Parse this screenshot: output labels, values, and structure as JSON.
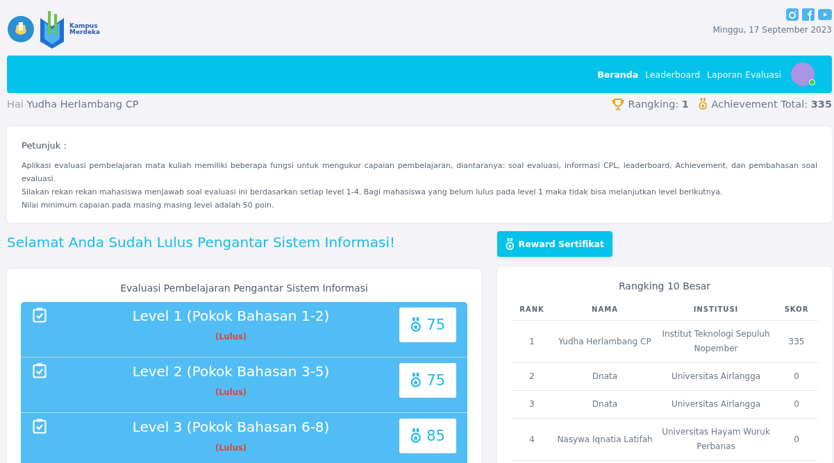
{
  "logo": {
    "line_1": "Kampus",
    "line_2": "Merdeka"
  },
  "date": "Minggu, 17 September 2023",
  "nav": [
    {
      "label": "Beranda",
      "selected": true
    },
    {
      "label": "Leaderboard",
      "selected": false
    },
    {
      "label": "Laporan Evaluasi",
      "selected": false
    }
  ],
  "user": {
    "online": true
  },
  "greeting": {
    "prefix": "Hai",
    "name": "Yudha Herlambang CP"
  },
  "stats": {
    "rank_label": "Rangking:",
    "rank": "1",
    "achievement_label": "Achievement Total:",
    "achievement": "335"
  },
  "instructions": {
    "title": "Petunjuk :",
    "paragraphs": [
      "Aplikasi evaluasi pembelajaran mata kuliah memiliki beberapa fungsi untuk mengukur capaian pembelajaran, diantaranya: soal evaluasi, informasi CPL, leaderboard, Achievement, dan pembahasan soal evaluasi.",
      "Silakan rekan rekan mahasiswa menjawab soal evaluasi ini berdasarkan setiap level 1-4. Bagi mahasiswa yang belum lulus pada level 1 maka tidak bisa melanjutkan level berikutnya.",
      "Nilai minimum capaian pada masing masing level adalah 50 poin."
    ]
  },
  "headline": "Selamat Anda Sudah Lulus Pengantar Sistem Informasi!",
  "reward_button": "Reward Sertifikat",
  "evaluation": {
    "title": "Evaluasi Pembelajaran Pengantar Sistem Informasi",
    "levels": [
      {
        "title": "Level 1 (Pokok Bahasan 1-2)",
        "status": "(Lulus)",
        "score": "75"
      },
      {
        "title": "Level 2 (Pokok Bahasan 3-5)",
        "status": "(Lulus)",
        "score": "75"
      },
      {
        "title": "Level 3 (Pokok Bahasan 6-8)",
        "status": "(Lulus)",
        "score": "85"
      }
    ]
  },
  "ranking": {
    "title": "Rangking 10 Besar",
    "columns": [
      "RANK",
      "NAMA",
      "INSTITUSI",
      "SKOR"
    ],
    "rows": [
      [
        "1",
        "Yudha Herlambang CP",
        "Institut Teknologi Sepuluh Nopember",
        "335"
      ],
      [
        "2",
        "Dnata",
        "Universitas Airlangga",
        "0"
      ],
      [
        "3",
        "Dnata",
        "Universitas Airlangga",
        "0"
      ],
      [
        "4",
        "Nasywa Iqnatia Latifah",
        "Universitas Hayam Wuruk Perbanas",
        "0"
      ]
    ]
  }
}
